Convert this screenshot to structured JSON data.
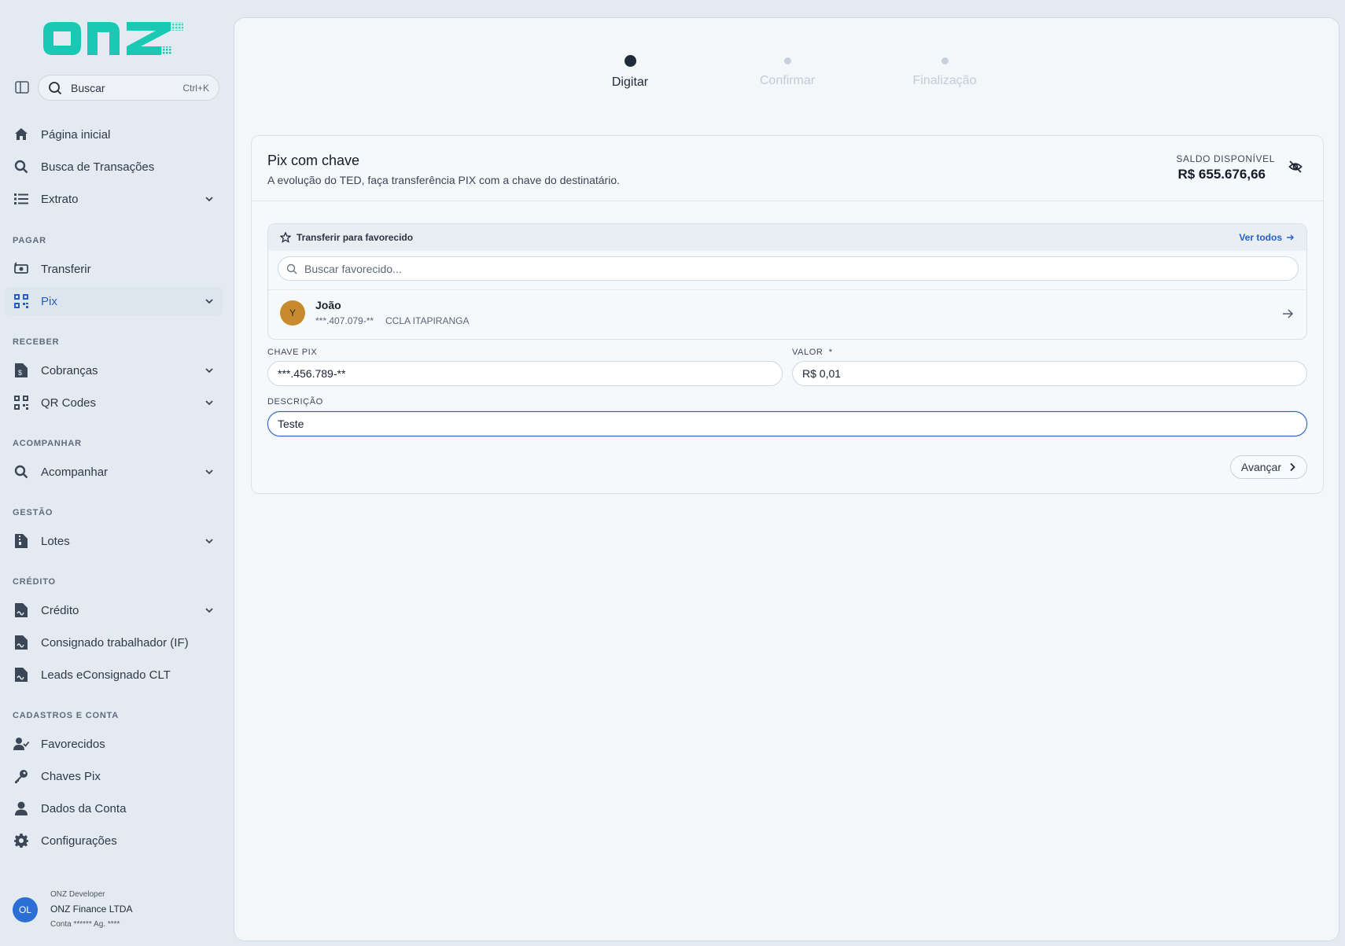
{
  "brand": {
    "logo_text": "onz",
    "accent": "#19c9b4"
  },
  "search": {
    "label": "Buscar",
    "shortcut": "Ctrl+K"
  },
  "nav": {
    "top": [
      {
        "label": "Página inicial",
        "icon": "home-icon"
      },
      {
        "label": "Busca de Transações",
        "icon": "search-icon"
      },
      {
        "label": "Extrato",
        "icon": "list-icon"
      }
    ],
    "sections": {
      "pagar": "PAGAR",
      "receber": "RECEBER",
      "acompanhar": "ACOMPANHAR",
      "gestao": "GESTÃO",
      "credito": "CRÉDITO",
      "cadastros": "CADASTROS E CONTA"
    },
    "items": {
      "transferir": "Transferir",
      "pix": "Pix",
      "cobrancas": "Cobranças",
      "qrcodes": "QR Codes",
      "acompanhar": "Acompanhar",
      "lotes": "Lotes",
      "credito": "Crédito",
      "consignado": "Consignado trabalhador (IF)",
      "leads": "Leads eConsignado CLT",
      "favorecidos": "Favorecidos",
      "chaves": "Chaves Pix",
      "dados": "Dados da Conta",
      "config": "Configurações"
    }
  },
  "user": {
    "initials": "OL",
    "role": "ONZ Developer",
    "company": "ONZ Finance LTDA",
    "account": "Conta ****** Ag. ****"
  },
  "steps": [
    {
      "label": "Digitar",
      "active": true
    },
    {
      "label": "Confirmar",
      "active": false
    },
    {
      "label": "Finalização",
      "active": false
    }
  ],
  "card": {
    "title": "Pix com chave",
    "subtitle": "A evolução do TED, faça transferência PIX com a chave do destinatário.",
    "balance_label": "SALDO DISPONÍVEL",
    "balance_value": "R$ 655.676,66"
  },
  "favorites": {
    "title": "Transferir para favorecido",
    "see_all": "Ver todos",
    "search_placeholder": "Buscar favorecido...",
    "items": [
      {
        "initial": "Y",
        "name": "João",
        "document": "***.407.079-**",
        "bank": "CCLA ITAPIRANGA"
      }
    ]
  },
  "form": {
    "pix_key_label": "CHAVE PIX",
    "pix_key_value": "***.456.789-**",
    "amount_label": "VALOR  *",
    "amount_value": "R$ 0,01",
    "description_label": "DESCRIÇÃO",
    "description_value": "Teste",
    "next_button": "Avançar"
  }
}
